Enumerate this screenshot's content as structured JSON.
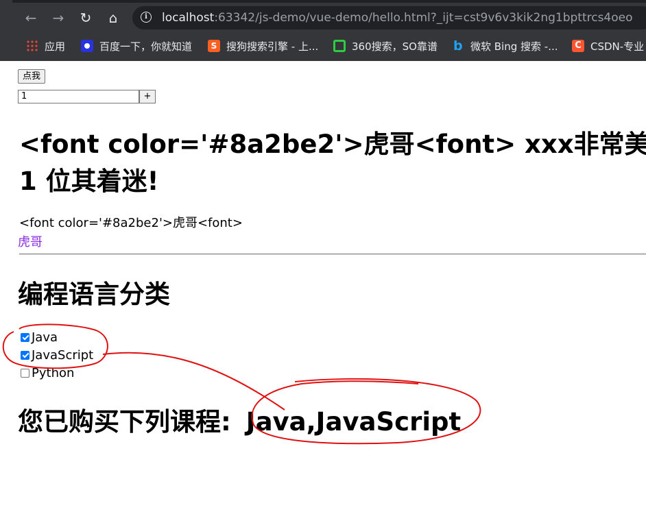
{
  "browser": {
    "url_host": "localhost",
    "url_rest": ":63342/js-demo/vue-demo/hello.html?_ijt=cst9v6v3kik2ng1bpttrcs4oeo",
    "bookmarks": [
      {
        "label": "应用",
        "icon": "apps-grid-icon"
      },
      {
        "label": "百度一下，你就知道",
        "icon": "baidu-icon"
      },
      {
        "label": "搜狗搜索引擎 - 上...",
        "icon": "sogou-icon"
      },
      {
        "label": "360搜索，SO靠谱",
        "icon": "360-search-icon"
      },
      {
        "label": "微软 Bing 搜索 -...",
        "icon": "bing-icon"
      },
      {
        "label": "CSDN-专业",
        "icon": "csdn-icon"
      }
    ]
  },
  "page": {
    "click_button_label": "点我",
    "counter_value": "1",
    "plus_label": "+",
    "heading_line1": "<font color='#8a2be2'>虎哥<font> xxx非常美",
    "heading_line2": "1 位其着迷!",
    "raw_html_text": "<font color='#8a2be2'>虎哥<font>",
    "rendered_text": "虎哥",
    "rendered_color": "#8a2be2",
    "section_title": "编程语言分类",
    "languages": [
      {
        "label": "Java",
        "checked": true
      },
      {
        "label": "JavaScript",
        "checked": true
      },
      {
        "label": "Python",
        "checked": false
      }
    ],
    "bought_label": "您已购买下列课程:",
    "bought_courses": "Java,JavaScript"
  },
  "annotation_color": "#e01010"
}
